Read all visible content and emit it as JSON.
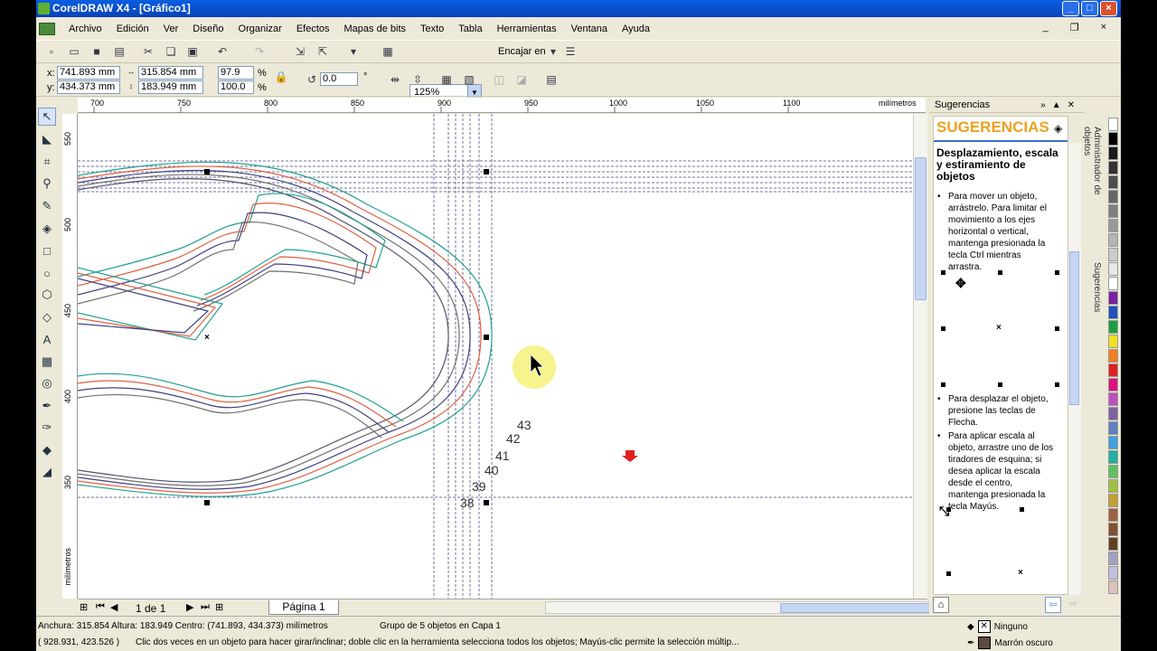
{
  "window": {
    "title": "CorelDRAW X4 - [Gráfico1]",
    "minimize": "_",
    "maximize": "□",
    "close": "×"
  },
  "menu": [
    "Archivo",
    "Edición",
    "Ver",
    "Diseño",
    "Organizar",
    "Efectos",
    "Mapas de bits",
    "Texto",
    "Tabla",
    "Herramientas",
    "Ventana",
    "Ayuda"
  ],
  "mdi": {
    "minimize": "_",
    "restore": "❐",
    "close": "×"
  },
  "toolbar": {
    "zoom": "125%",
    "snap": "Encajar en"
  },
  "props": {
    "x_label": "x:",
    "x_val": "741.893 mm",
    "y_label": "y:",
    "y_val": "434.373 mm",
    "w_val": "315.854 mm",
    "h_val": "183.949 mm",
    "sx_val": "97.9",
    "sy_val": "100.0",
    "pct": "%",
    "rot_val": "0.0",
    "deg": "°"
  },
  "ruler": {
    "h_ticks": [
      "700",
      "750",
      "800",
      "850",
      "900",
      "950",
      "1000",
      "1050",
      "1100"
    ],
    "h_unit": "milímetros",
    "v_ticks": [
      "550",
      "500",
      "450",
      "400",
      "350"
    ],
    "v_unit": "milímetros"
  },
  "canvas": {
    "labels": [
      "43",
      "42",
      "41",
      "40",
      "39",
      "38"
    ]
  },
  "pagenav": {
    "count": "1 de 1",
    "tab": "Página 1"
  },
  "status": {
    "dims": "Anchura: 315.854  Altura: 183.949  Centro: (741.893, 434.373)  milímetros",
    "selection": "Grupo de 5 objetos en Capa 1",
    "coords": "( 928.931, 423.526 )",
    "hint": "Clic dos veces en un objeto para hacer girar/inclinar; doble clic en la herramienta selecciona todos los objetos; Mayús-clic permite la selección múltip...",
    "fill": "Ninguno",
    "stroke": "Marrón oscuro",
    "stroke_color": "#5a4a42"
  },
  "docker": {
    "header": "Sugerencias",
    "title": "SUGERENCIAS",
    "heading": "Desplazamiento, escala y estiramiento de objetos",
    "tip1": "Para mover un objeto, arrástrelo. Para limitar el movimiento a los ejes horizontal o vertical, mantenga presionada la tecla Ctrl mientras arrastra.",
    "tip2": "Para desplazar el objeto, presione las teclas de Flecha.",
    "tip3": "Para aplicar escala al objeto, arrastre uno de los tiradores de esquina; si desea aplicar la escala desde el centro, mantenga presionada la tecla Mayús.",
    "tab_objects": "Administrador de objetos",
    "tab_tips": "Sugerencias"
  },
  "palette": [
    "#ffffff",
    "#000000",
    "#1a1a1a",
    "#333333",
    "#4d4d4d",
    "#666666",
    "#808080",
    "#999999",
    "#b3b3b3",
    "#cccccc",
    "#e6e6e6",
    "#ffffff",
    "#7a1fa0",
    "#2050c0",
    "#18a040",
    "#f0e020",
    "#f08020",
    "#e02020",
    "#e01080",
    "#c050c0",
    "#8060a0",
    "#6080c0",
    "#40a0e0",
    "#20b0a0",
    "#60c060",
    "#a0c040",
    "#c0a030",
    "#a06040",
    "#805030",
    "#604020",
    "#a0a0c0",
    "#c0c0e0",
    "#e0c0c0"
  ]
}
